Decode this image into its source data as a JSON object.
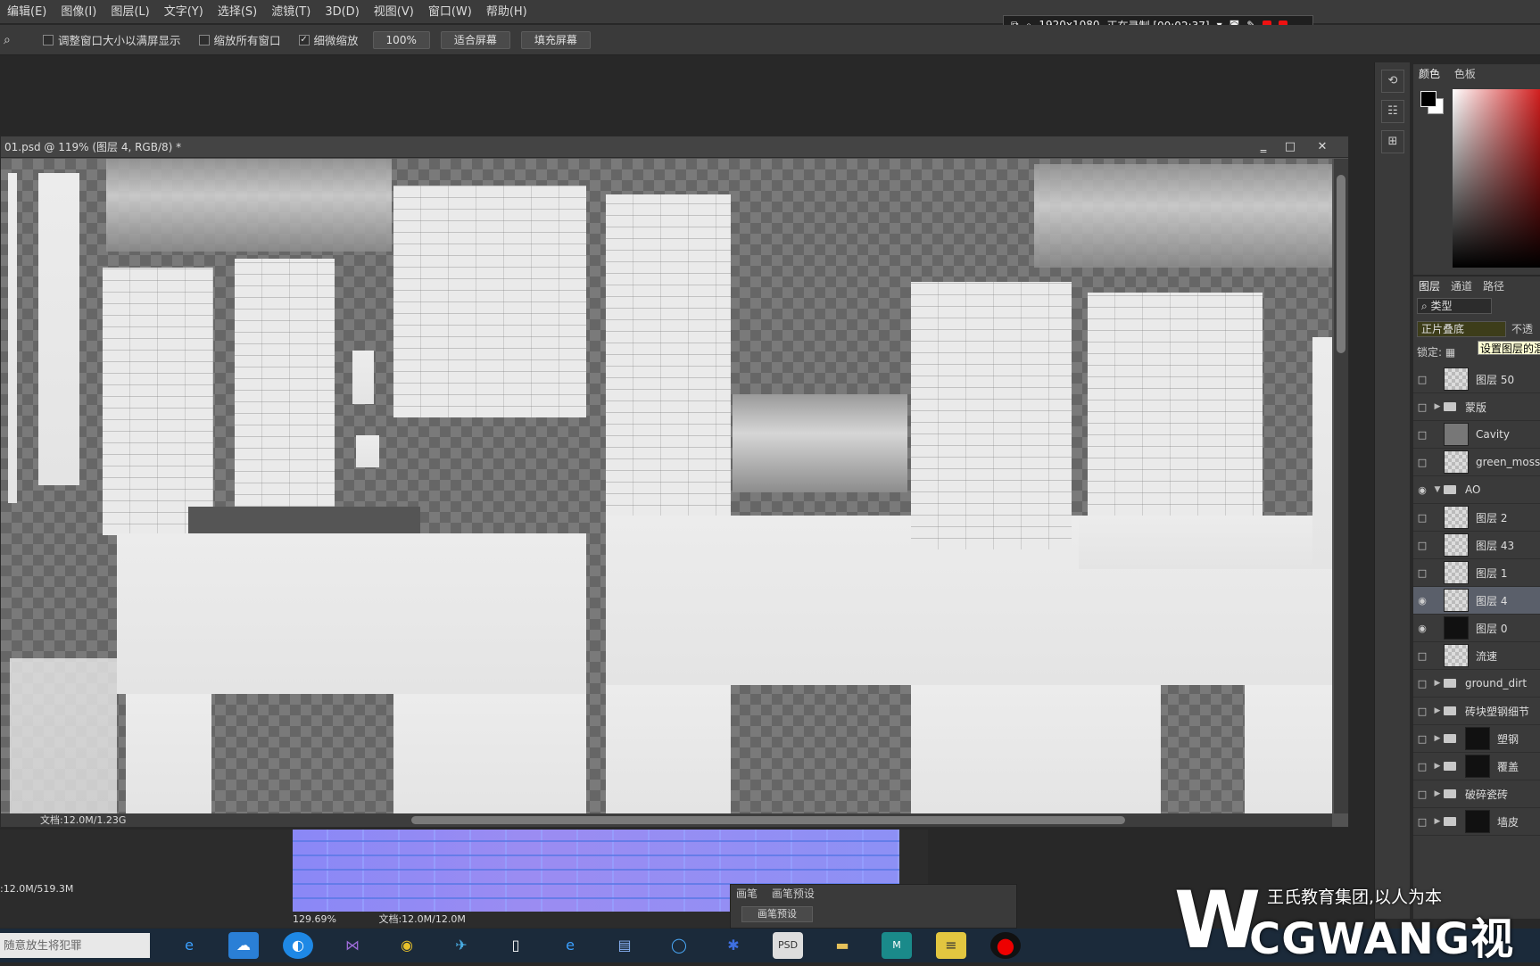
{
  "menu": [
    "编辑(E)",
    "图像(I)",
    "图层(L)",
    "文字(Y)",
    "选择(S)",
    "滤镜(T)",
    "3D(D)",
    "视图(V)",
    "窗口(W)",
    "帮助(H)"
  ],
  "recorder": {
    "resolution": "1920x1080",
    "status": "正在录制 [00:02:37]"
  },
  "options": {
    "resize_windows": "调整窗口大小以满屏显示",
    "zoom_all": "缩放所有窗口",
    "scrubby_zoom": "细微缩放",
    "scrubby_checked": true,
    "zoom_value": "100%",
    "fit_screen": "适合屏幕",
    "fill_screen": "填充屏幕"
  },
  "document": {
    "title": "01.psd @ 119% (图层 4, RGB/8) *",
    "status": "文档:12.0M/1.23G"
  },
  "document2": {
    "status_left": ":12.0M/519.3M",
    "zoom": "129.69%",
    "status": "文档:12.0M/12.0M"
  },
  "brush_panel": {
    "tab1": "画笔",
    "tab2": "画笔预设",
    "button": "画笔预设"
  },
  "color_panel": {
    "tab1": "颜色",
    "tab2": "色板"
  },
  "layers_panel": {
    "tabs": [
      "图层",
      "通道",
      "路径"
    ],
    "filter": "类型",
    "blend_mode": "正片叠底",
    "opacity_label": "不透",
    "lock_label": "锁定:",
    "tooltip": "设置图层的混",
    "layers": [
      {
        "name": "图层 50",
        "kind": "layer",
        "visible": false
      },
      {
        "name": "蒙版",
        "kind": "group",
        "visible": false
      },
      {
        "name": "Cavity",
        "kind": "layer-grey",
        "visible": false
      },
      {
        "name": "green_moss",
        "kind": "layer",
        "visible": false
      },
      {
        "name": "AO",
        "kind": "group-open",
        "visible": true
      },
      {
        "name": "图层 2",
        "kind": "layer",
        "visible": false
      },
      {
        "name": "图层 43",
        "kind": "layer",
        "visible": false
      },
      {
        "name": "图层 1",
        "kind": "layer",
        "visible": false
      },
      {
        "name": "图层 4",
        "kind": "layer",
        "visible": true,
        "selected": true
      },
      {
        "name": "图层 0",
        "kind": "layer-dark",
        "visible": true
      },
      {
        "name": "流速",
        "kind": "layer-mask",
        "visible": false
      },
      {
        "name": "ground_dirt",
        "kind": "group",
        "visible": false
      },
      {
        "name": "砖块塑钢细节",
        "kind": "group",
        "visible": false
      },
      {
        "name": "塑钢",
        "kind": "group-mask",
        "visible": false
      },
      {
        "name": "覆盖",
        "kind": "group-mask",
        "visible": false
      },
      {
        "name": "破碎瓷砖",
        "kind": "group",
        "visible": false
      },
      {
        "name": "墙皮",
        "kind": "group-mask",
        "visible": false
      }
    ]
  },
  "taskbar": {
    "search_placeholder": "随意放生将犯罪"
  },
  "watermark": {
    "line1": "王氏教育集团,以人为本",
    "line2": "CGWANG视",
    "logo": "W"
  }
}
